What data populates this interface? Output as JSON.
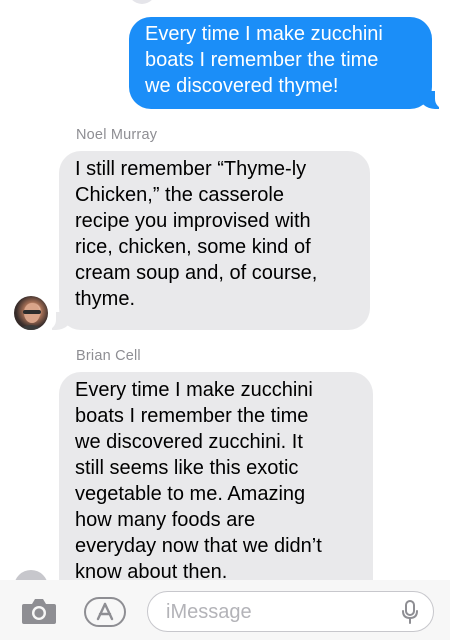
{
  "conversation": {
    "messages": [
      {
        "direction": "outgoing",
        "text": "Every time I make zucchini\nboats I remember the time\nwe discovered thyme!"
      },
      {
        "direction": "incoming",
        "sender": "Noel Murray",
        "text": "I still remember “Thyme-ly\nChicken,” the casserole\nrecipe you improvised with\nrice, chicken, some kind of\ncream soup and, of course,\nthyme."
      },
      {
        "direction": "incoming",
        "sender": "Brian Cell",
        "text": "Every time I make zucchini\nboats I remember the time\nwe discovered zucchini. It\nstill seems like this exotic\nvegetable to me. Amazing\nhow many foods are\neveryday now that we didn’t\nknow about then."
      }
    ]
  },
  "composer": {
    "placeholder": "iMessage",
    "icons": {
      "camera": "camera-icon",
      "apps": "app-store-icon",
      "microphone": "microphone-icon"
    }
  },
  "colors": {
    "outgoing_bubble": "#1b8ef8",
    "incoming_bubble": "#e9e9eb",
    "sender_label": "#8e8e93",
    "icon_gray": "#8e8e93"
  }
}
